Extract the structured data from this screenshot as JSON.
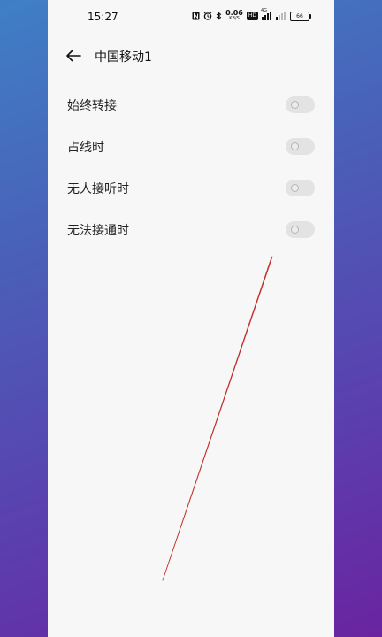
{
  "status_bar": {
    "time": "15:27",
    "net_speed_value": "0.06",
    "net_speed_unit": "KB/S",
    "hd_label": "HD",
    "signal_label": "4G",
    "battery_level": "66"
  },
  "header": {
    "title": "中国移动1"
  },
  "settings": {
    "items": [
      {
        "label": "始终转接",
        "enabled": false
      },
      {
        "label": "占线时",
        "enabled": false
      },
      {
        "label": "无人接听时",
        "enabled": false
      },
      {
        "label": "无法接通时",
        "enabled": false
      }
    ]
  },
  "colors": {
    "annotation_line": "#c0302a",
    "toggle_off": "#e3e3e3"
  }
}
